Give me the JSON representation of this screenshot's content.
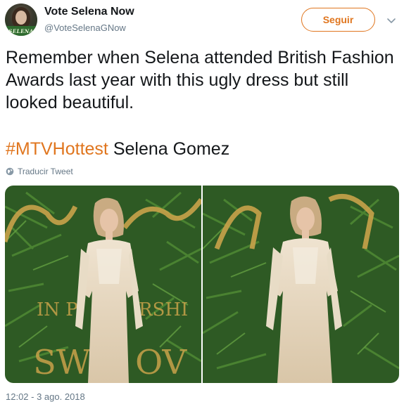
{
  "user": {
    "display_name": "Vote Selena Now",
    "handle": "@VoteSelenaGNow",
    "avatar_logo": "SELENA"
  },
  "actions": {
    "follow_label": "Seguir",
    "menu_icon": "chevron-down-icon"
  },
  "tweet": {
    "text": "Remember when Selena attended British Fashion Awards last year with this ugly dress but still looked beautiful.",
    "hashtag": "#MTVHottest",
    "after_hashtag": " Selena Gomez",
    "translate_label": "Traducir Tweet",
    "timestamp": "12:02 - 3 ago. 2018"
  },
  "colors": {
    "accent": "#e0761f",
    "secondary_text": "#657786"
  }
}
